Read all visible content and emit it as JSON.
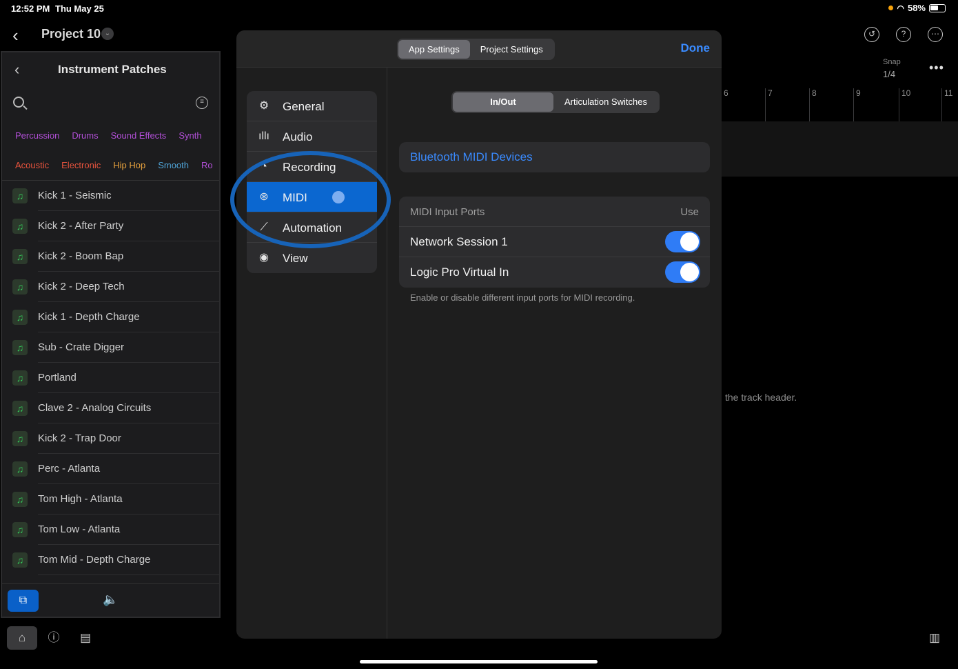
{
  "status": {
    "time": "12:52 PM",
    "date": "Thu May 25",
    "battery": "58%"
  },
  "topbar": {
    "title": "Project 10"
  },
  "left_panel": {
    "title": "Instrument Patches",
    "chips_row1": [
      {
        "label": "Percussion",
        "color": "#b14fd6"
      },
      {
        "label": "Drums",
        "color": "#b14fd6"
      },
      {
        "label": "Sound Effects",
        "color": "#b14fd6"
      },
      {
        "label": "Synth",
        "color": "#b14fd6"
      }
    ],
    "chips_row2": [
      {
        "label": "Acoustic",
        "color": "#e8533d"
      },
      {
        "label": "Electronic",
        "color": "#e8533d"
      },
      {
        "label": "Hip Hop",
        "color": "#e8a23d"
      },
      {
        "label": "Smooth",
        "color": "#4fa3d6"
      },
      {
        "label": "Ro",
        "color": "#b14fd6"
      }
    ],
    "patches": [
      "Kick 1 - Seismic",
      "Kick 2 - After Party",
      "Kick 2 - Boom Bap",
      "Kick 2 - Deep Tech",
      "Kick 1 - Depth Charge",
      "Sub - Crate Digger",
      "Portland",
      "Clave 2 - Analog Circuits",
      "Kick 2 - Trap Door",
      "Perc - Atlanta",
      "Tom High - Atlanta",
      "Tom Low - Atlanta",
      "Tom Mid - Depth Charge"
    ]
  },
  "arrange": {
    "snap_label": "Snap",
    "snap_value": "1/4",
    "ruler": [
      "6",
      "7",
      "8",
      "9",
      "10",
      "11"
    ],
    "hint": "the track header."
  },
  "modal": {
    "tabs": [
      "App Settings",
      "Project Settings"
    ],
    "active_tab": "App Settings",
    "done_label": "Done",
    "nav": [
      {
        "label": "General",
        "icon": "gear-icon"
      },
      {
        "label": "Audio",
        "icon": "waveform-icon"
      },
      {
        "label": "Recording",
        "icon": "record-icon"
      },
      {
        "label": "MIDI",
        "icon": "midi-icon"
      },
      {
        "label": "Automation",
        "icon": "automation-icon"
      },
      {
        "label": "View",
        "icon": "eye-icon"
      }
    ],
    "active_nav": "MIDI",
    "subtabs": [
      "In/Out",
      "Articulation Switches"
    ],
    "active_subtab": "In/Out",
    "bluetooth_label": "Bluetooth MIDI Devices",
    "ports_header": "MIDI Input Ports",
    "ports_use": "Use",
    "ports": [
      {
        "name": "Network Session 1",
        "enabled": true
      },
      {
        "name": "Logic Pro Virtual In",
        "enabled": true
      }
    ],
    "footnote": "Enable or disable different input ports for MIDI recording."
  }
}
